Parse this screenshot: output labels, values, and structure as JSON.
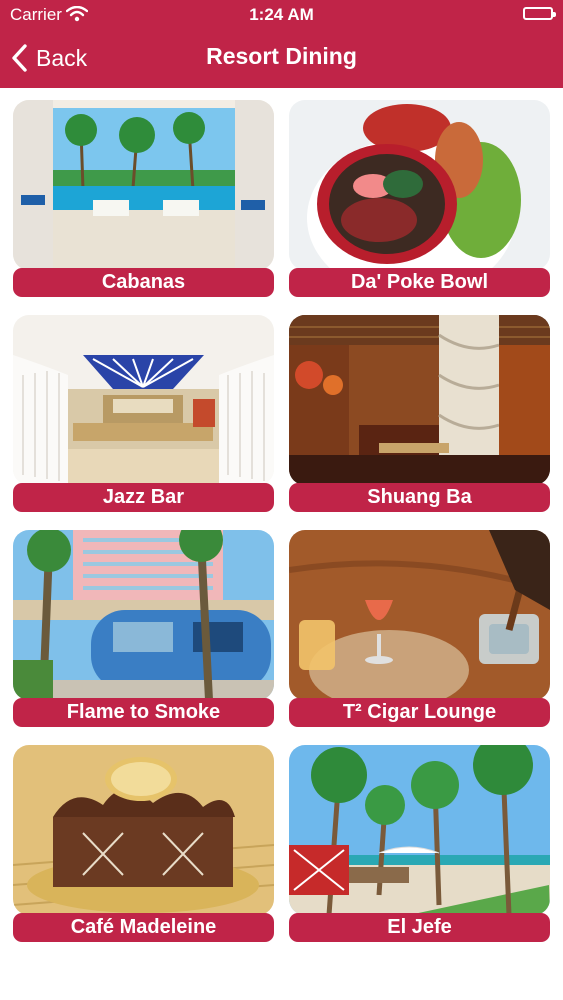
{
  "status_bar": {
    "carrier": "Carrier",
    "time": "1:24 AM",
    "wifi_icon": "wifi-icon",
    "battery_icon": "battery-icon"
  },
  "nav": {
    "back_label": "Back",
    "back_icon": "chevron-left-icon",
    "title": "Resort Dining"
  },
  "colors": {
    "brand": "#c02448",
    "text_on_brand": "#ffffff",
    "background": "#ffffff"
  },
  "venues": [
    {
      "label": "Cabanas"
    },
    {
      "label": "Da' Poke Bowl"
    },
    {
      "label": "Jazz Bar"
    },
    {
      "label": "Shuang Ba"
    },
    {
      "label": "Flame to Smoke"
    },
    {
      "label": "T² Cigar Lounge"
    },
    {
      "label": "Café Madeleine"
    },
    {
      "label": "El Jefe"
    }
  ]
}
